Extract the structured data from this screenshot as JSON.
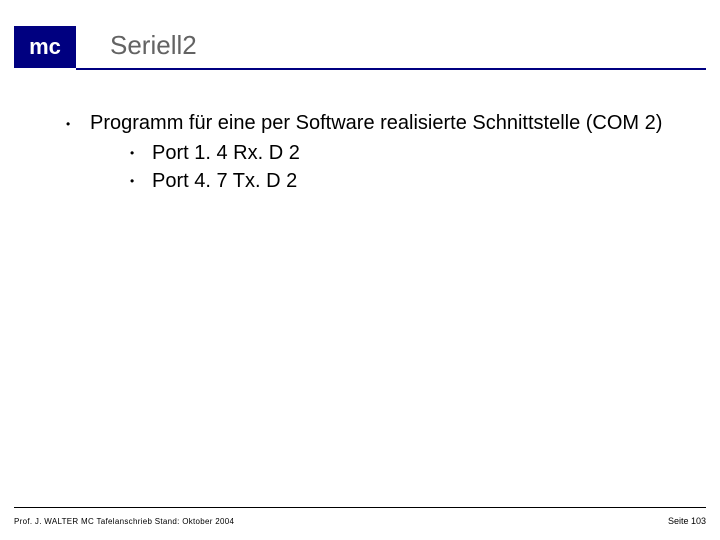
{
  "header": {
    "logo": "mc",
    "title": "Seriell2"
  },
  "content": {
    "bullet_main": "Programm für eine per Software realisierte Schnittstelle (COM 2)",
    "sub_bullets": {
      "0": "Port 1. 4 Rx. D 2",
      "1": "Port 4. 7 Tx. D 2"
    }
  },
  "footer": {
    "left": "Prof. J. WALTER  MC Tafelanschrieb  Stand: Oktober 2004",
    "right": "Seite 103"
  }
}
